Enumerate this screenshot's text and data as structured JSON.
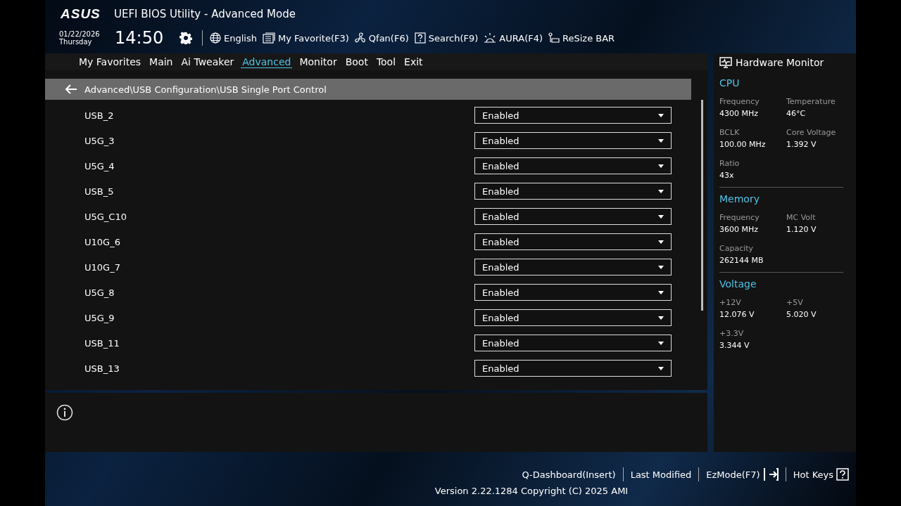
{
  "header": {
    "brand": "ASUS",
    "title": "UEFI BIOS Utility - Advanced Mode",
    "date": "01/22/2026",
    "weekday": "Thursday",
    "time": "14:50",
    "tools": [
      {
        "kind": "globe",
        "label": "English"
      },
      {
        "kind": "favorite",
        "label": "My Favorite(F3)"
      },
      {
        "kind": "fan",
        "label": "Qfan(F6)"
      },
      {
        "kind": "search",
        "label": "Search(F9)"
      },
      {
        "kind": "aura",
        "label": "AURA(F4)"
      },
      {
        "kind": "resize",
        "label": "ReSize BAR"
      }
    ]
  },
  "tabs": [
    {
      "label": "My Favorites",
      "selected": false
    },
    {
      "label": "Main",
      "selected": false
    },
    {
      "label": "Ai Tweaker",
      "selected": false
    },
    {
      "label": "Advanced",
      "selected": true
    },
    {
      "label": "Monitor",
      "selected": false
    },
    {
      "label": "Boot",
      "selected": false
    },
    {
      "label": "Tool",
      "selected": false
    },
    {
      "label": "Exit",
      "selected": false
    }
  ],
  "breadcrumb": "Advanced\\USB Configuration\\USB Single Port Control",
  "settings": [
    {
      "label": "USB_2",
      "value": "Enabled"
    },
    {
      "label": "U5G_3",
      "value": "Enabled"
    },
    {
      "label": "U5G_4",
      "value": "Enabled"
    },
    {
      "label": "USB_5",
      "value": "Enabled"
    },
    {
      "label": "U5G_C10",
      "value": "Enabled"
    },
    {
      "label": "U10G_6",
      "value": "Enabled"
    },
    {
      "label": "U10G_7",
      "value": "Enabled"
    },
    {
      "label": "U5G_8",
      "value": "Enabled"
    },
    {
      "label": "U5G_9",
      "value": "Enabled"
    },
    {
      "label": "USB_11",
      "value": "Enabled"
    },
    {
      "label": "USB_13",
      "value": "Enabled"
    }
  ],
  "hardware_monitor": {
    "title": "Hardware Monitor",
    "sections": [
      {
        "title": "CPU",
        "items": [
          {
            "label": "Frequency",
            "value": "4300 MHz"
          },
          {
            "label": "Temperature",
            "value": "46°C"
          },
          {
            "label": "BCLK",
            "value": "100.00 MHz"
          },
          {
            "label": "Core Voltage",
            "value": "1.392 V"
          },
          {
            "label": "Ratio",
            "value": "43x"
          }
        ]
      },
      {
        "title": "Memory",
        "items": [
          {
            "label": "Frequency",
            "value": "3600 MHz"
          },
          {
            "label": "MC Volt",
            "value": "1.120 V"
          },
          {
            "label": "Capacity",
            "value": "262144 MB"
          }
        ]
      },
      {
        "title": "Voltage",
        "items": [
          {
            "label": "+12V",
            "value": "12.076 V"
          },
          {
            "label": "+5V",
            "value": "5.020 V"
          },
          {
            "label": "+3.3V",
            "value": "3.344 V"
          }
        ]
      }
    ]
  },
  "footer": {
    "links": [
      {
        "kind": "text",
        "label": "Q-Dashboard(Insert)"
      },
      {
        "kind": "text",
        "label": "Last Modified"
      },
      {
        "kind": "exit",
        "label": "EzMode(F7)"
      },
      {
        "kind": "help",
        "label": "Hot Keys"
      }
    ],
    "version": "Version 2.22.1284 Copyright (C) 2025 AMI"
  }
}
